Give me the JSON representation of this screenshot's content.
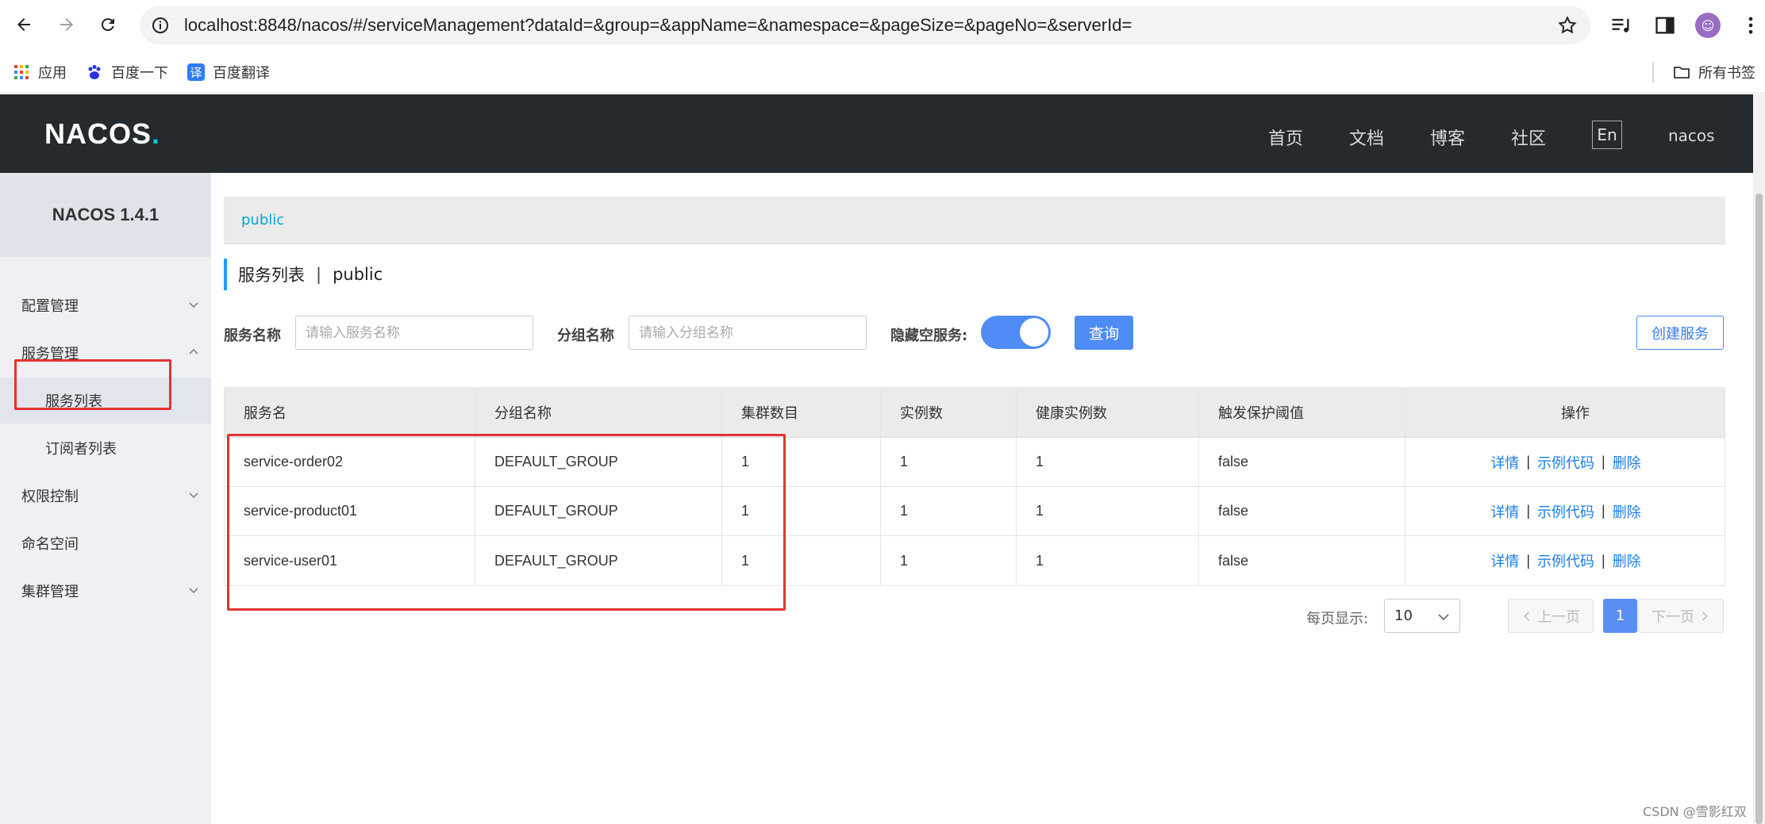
{
  "browser": {
    "url": "localhost:8848/nacos/#/serviceManagement?dataId=&group=&appName=&namespace=&pageSize=&pageNo=&serverId=",
    "bookmarks": [
      "应用",
      "百度一下",
      "百度翻译"
    ],
    "all_bookmarks": "所有书签"
  },
  "header": {
    "logo": "NACOS",
    "nav": [
      "首页",
      "文档",
      "博客",
      "社区"
    ],
    "lang": "En",
    "user": "nacos"
  },
  "sidebar": {
    "title": "NACOS 1.4.1",
    "items": [
      {
        "label": "配置管理"
      },
      {
        "label": "服务管理"
      },
      {
        "label": "服务列表"
      },
      {
        "label": "订阅者列表"
      },
      {
        "label": "权限控制"
      },
      {
        "label": "命名空间"
      },
      {
        "label": "集群管理"
      }
    ]
  },
  "namespace": "public",
  "page": {
    "title": "服务列表",
    "separator": "|",
    "namespace": "public"
  },
  "filters": {
    "service_label": "服务名称",
    "service_placeholder": "请输入服务名称",
    "group_label": "分组名称",
    "group_placeholder": "请输入分组名称",
    "hide_empty_label": "隐藏空服务:",
    "hide_empty": true,
    "query_button": "查询",
    "create_button": "创建服务"
  },
  "table": {
    "headers": [
      "服务名",
      "分组名称",
      "集群数目",
      "实例数",
      "健康实例数",
      "触发保护阈值",
      "操作"
    ],
    "rows": [
      {
        "name": "service-order02",
        "group": "DEFAULT_GROUP",
        "clusters": "1",
        "instances": "1",
        "healthy": "1",
        "threshold": "false"
      },
      {
        "name": "service-product01",
        "group": "DEFAULT_GROUP",
        "clusters": "1",
        "instances": "1",
        "healthy": "1",
        "threshold": "false"
      },
      {
        "name": "service-user01",
        "group": "DEFAULT_GROUP",
        "clusters": "1",
        "instances": "1",
        "healthy": "1",
        "threshold": "false"
      }
    ],
    "actions": {
      "detail": "详情",
      "sample": "示例代码",
      "delete": "删除"
    }
  },
  "pagination": {
    "per_page_label": "每页显示:",
    "page_size": "10",
    "prev": "上一页",
    "current": "1",
    "next": "下一页"
  },
  "watermark": "CSDN @雪影红双",
  "colors": {
    "accent": "#4f8cf5",
    "header_bg": "#252a2f",
    "link": "#1f7ee6",
    "highlight_box": "#e53232"
  }
}
